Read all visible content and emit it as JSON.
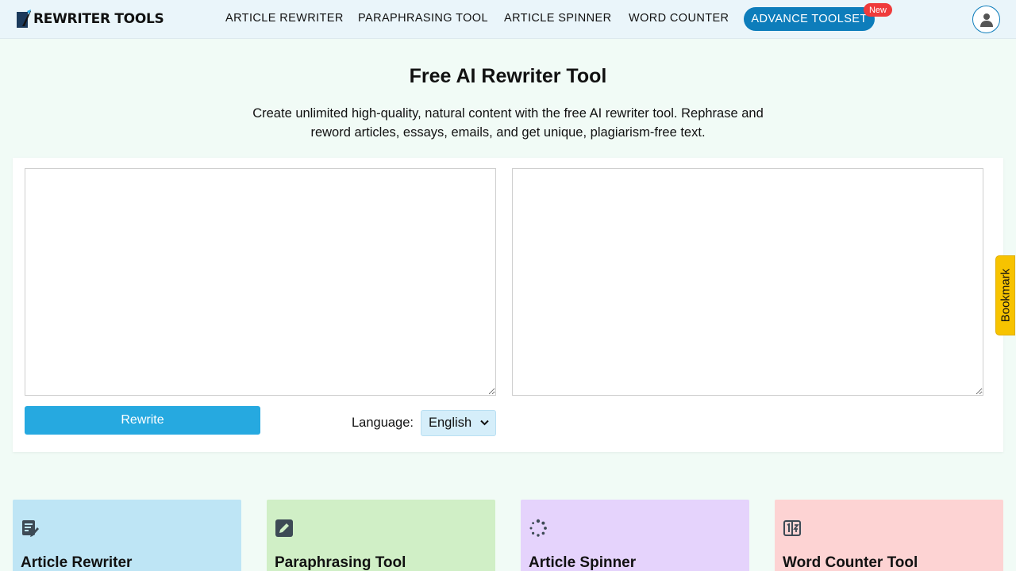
{
  "header": {
    "logo_text": "REWRITER TOOLS",
    "nav": [
      {
        "label": "ARTICLE REWRITER"
      },
      {
        "label": "PARAPHRASING TOOL"
      },
      {
        "label": "ARTICLE SPINNER"
      },
      {
        "label": "WORD COUNTER"
      }
    ],
    "advance_label": "ADVANCE TOOLSET",
    "new_badge": "New"
  },
  "hero": {
    "title": "Free AI Rewriter Tool",
    "subtitle_line1": "Create unlimited high-quality, natural content with the free AI rewriter tool. Rephrase and",
    "subtitle_line2": "reword articles, essays, emails, and get unique, plagiarism-free text."
  },
  "tool": {
    "input_value": "",
    "output_value": "",
    "rewrite_label": "Rewrite",
    "language_label": "Language:",
    "language_value": "English"
  },
  "bookmark_label": "Bookmark",
  "cards": [
    {
      "title": "Article Rewriter",
      "bg": "#bee5f5",
      "icon": "edit-note-icon"
    },
    {
      "title": "Paraphrasing Tool",
      "bg": "#d0efc6",
      "icon": "pencil-icon"
    },
    {
      "title": "Article Spinner",
      "bg": "#e5d3fc",
      "icon": "spinner-icon"
    },
    {
      "title": "Word Counter Tool",
      "bg": "#fdd3d3",
      "icon": "counter-icon"
    }
  ],
  "colors": {
    "brand": "#0d7dbb",
    "rewrite_button": "#26a9e0",
    "badge": "#ef3b3b",
    "bookmark": "#f7c300"
  }
}
